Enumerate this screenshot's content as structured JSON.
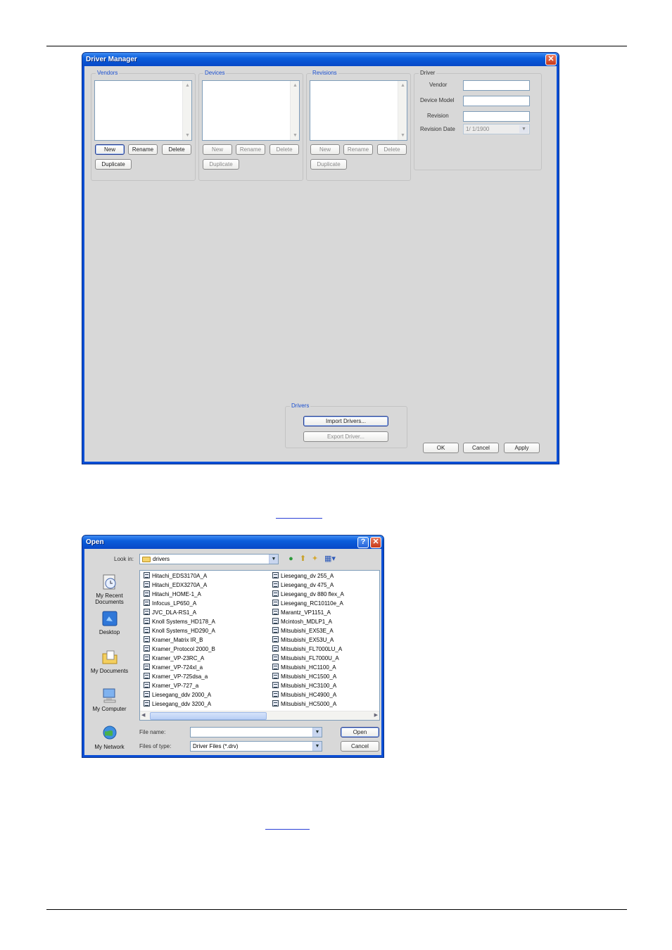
{
  "driver_manager": {
    "title": "Driver Manager",
    "close": "✕",
    "vendors": {
      "label": "Vendors",
      "new": "New",
      "rename": "Rename",
      "delete": "Delete",
      "duplicate": "Duplicate"
    },
    "devices": {
      "label": "Devices",
      "new": "New",
      "rename": "Rename",
      "delete": "Delete",
      "duplicate": "Duplicate"
    },
    "revisions": {
      "label": "Revisions",
      "new": "New",
      "rename": "Rename",
      "delete": "Delete",
      "duplicate": "Duplicate"
    },
    "driver": {
      "label": "Driver",
      "vendor": "Vendor",
      "device_model": "Device Model",
      "revision": "Revision",
      "revision_date": "Revision Date",
      "revision_date_value": "1/ 1/1900"
    },
    "drivers_group": {
      "label": "Drivers",
      "import": "Import Drivers...",
      "export": "Export Driver..."
    },
    "ok": "OK",
    "cancel": "Cancel",
    "apply": "Apply"
  },
  "open_dialog": {
    "title": "Open",
    "help": "?",
    "close": "✕",
    "look_in_label": "Look in:",
    "look_in_value": "drivers",
    "places": [
      "My Recent Documents",
      "Desktop",
      "My Documents",
      "My Computer",
      "My Network"
    ],
    "files_col1": [
      "Hitachi_EDS3170A_A",
      "Hitachi_EDX3270A_A",
      "Hitachi_HOME-1_A",
      "Infocus_LP650_A",
      "JVC_DLA-RS1_A",
      "Knoll Systems_HD178_A",
      "Knoll Systems_HD290_A",
      "Kramer_Matrix IR_B",
      "Kramer_Protocol 2000_B",
      "Kramer_VP-23RC_A",
      "Kramer_VP-724xl_a",
      "Kramer_VP-725dsa_a",
      "Kramer_VP-727_a",
      "Liesegang_ddv 2000_A",
      "Liesegang_ddv 3200_A"
    ],
    "files_col2": [
      "Liesegang_dv 255_A",
      "Liesegang_dv 475_A",
      "Liesegang_dv 880 flex_A",
      "Liesegang_RC10110e_A",
      "Marantz_VP1151_A",
      "Mcintosh_MDLP1_A",
      "Mitsubishi_EX53E_A",
      "Mitsubishi_EX53U_A",
      "Mitsubishi_FL7000LU_A",
      "Mitsubishi_FL7000U_A",
      "Mitsubishi_HC1100_A",
      "Mitsubishi_HC1500_A",
      "Mitsubishi_HC3100_A",
      "Mitsubishi_HC4900_A",
      "Mitsubishi_HC5000_A"
    ],
    "file_name_label": "File name:",
    "file_name_value": "",
    "files_of_type_label": "Files of type:",
    "files_of_type_value": "Driver Files (*.drv)",
    "open_button": "Open",
    "cancel_button": "Cancel"
  },
  "colors": {
    "titlebar": "#0a5ddb",
    "client": "#d8d8d8",
    "group_label": "#1a4fd0",
    "link": "#2a3fd6"
  }
}
